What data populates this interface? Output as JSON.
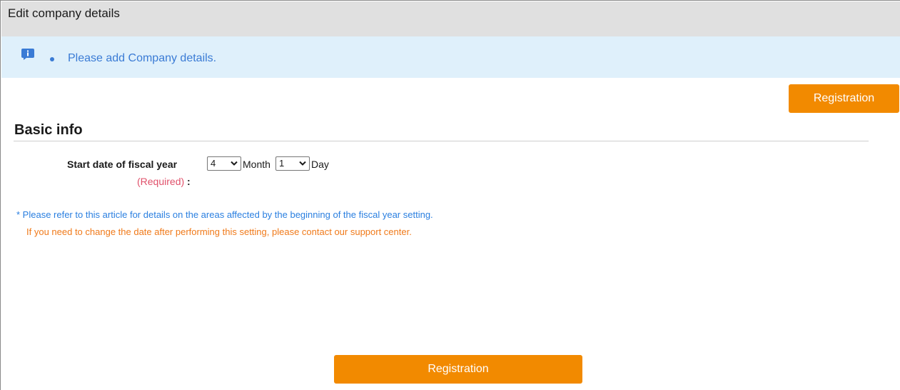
{
  "header": {
    "title": "Edit company details"
  },
  "info_banner": {
    "icon": "info-icon",
    "message": "Please add Company details.",
    "color": "#3a7bd5",
    "background": "#dff0fb"
  },
  "actions": {
    "register_top_label": "Registration",
    "register_bottom_label": "Registration",
    "accent_color": "#f28a00"
  },
  "section": {
    "title": "Basic info"
  },
  "fiscal_year": {
    "label": "Start date of fiscal year",
    "required": "(Required)",
    "colon": ":",
    "month_value": "4",
    "month_unit": "Month",
    "day_value": "1",
    "day_unit": "Day"
  },
  "notes": {
    "reference": "* Please refer to this article for details on the areas affected by the beginning of the fiscal year setting.",
    "support": "If you need to change the date after performing this setting, please contact our support center."
  }
}
